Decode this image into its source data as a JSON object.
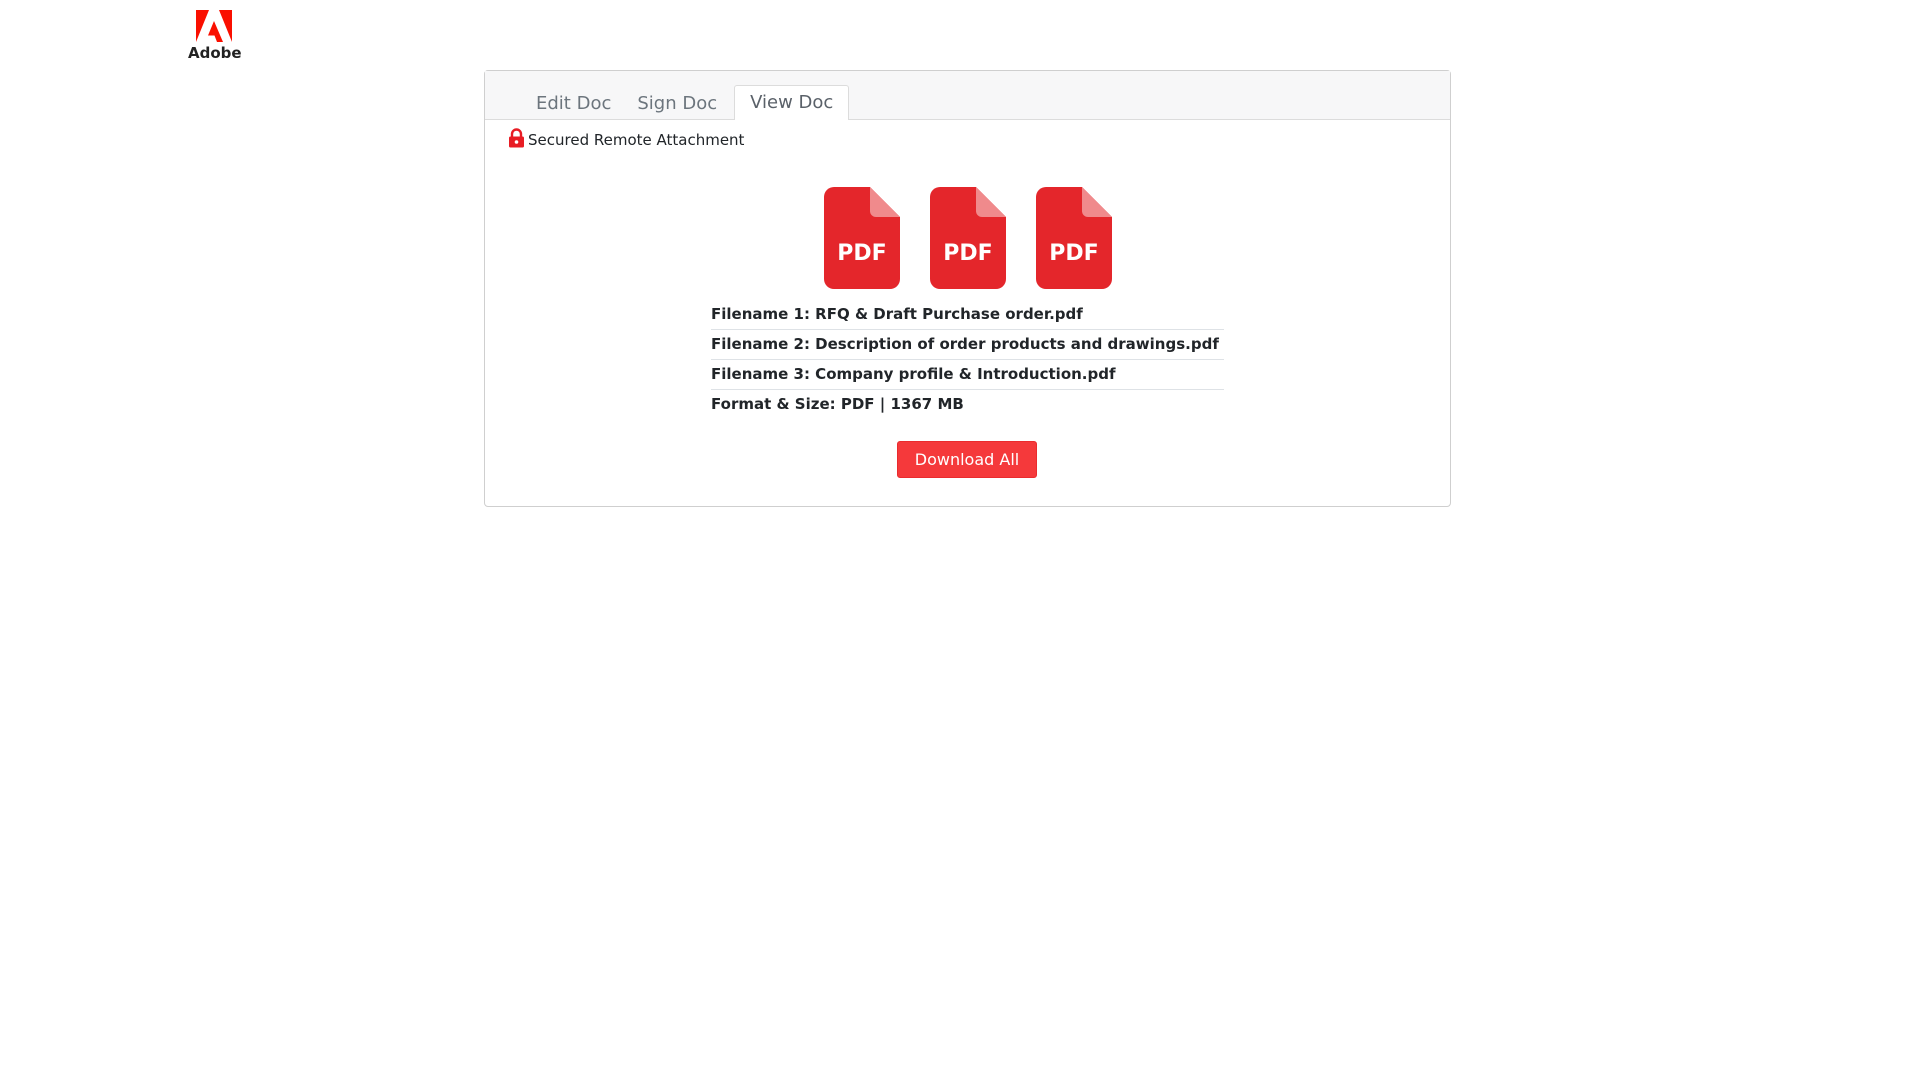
{
  "brand": {
    "name": "Adobe",
    "color": "#fa0f00"
  },
  "tabs": [
    {
      "label": "Edit Doc",
      "active": false
    },
    {
      "label": "Sign Doc",
      "active": false
    },
    {
      "label": "View Doc",
      "active": true
    }
  ],
  "secured_label": "Secured Remote Attachment",
  "pdf_icons": [
    {
      "label": "PDF",
      "icon": "pdf-file-icon"
    },
    {
      "label": "PDF",
      "icon": "pdf-file-icon"
    },
    {
      "label": "PDF",
      "icon": "pdf-file-icon"
    }
  ],
  "files": [
    "Filename 1: RFQ & Draft Purchase order.pdf",
    "Filename 2: Description of order products and drawings.pdf",
    "Filename 3: Company profile & Introduction.pdf",
    "Format & Size: PDF | 1367 MB"
  ],
  "download_button": "Download All",
  "colors": {
    "accent": "#f5393b",
    "pdf_red": "#e4262b",
    "lock_red": "#e81c24"
  }
}
